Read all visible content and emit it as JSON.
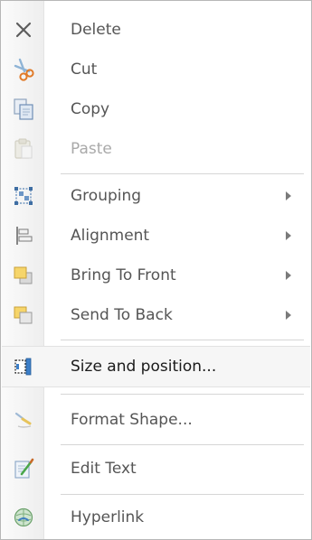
{
  "menu": {
    "items": [
      {
        "label": "Delete",
        "icon": "delete-x-icon"
      },
      {
        "label": "Cut",
        "icon": "scissors-icon"
      },
      {
        "label": "Copy",
        "icon": "copy-icon"
      },
      {
        "label": "Paste",
        "icon": "paste-icon",
        "enabled": false
      },
      {
        "label": "Grouping",
        "icon": "grouping-icon",
        "submenu": true
      },
      {
        "label": "Alignment",
        "icon": "alignment-icon",
        "submenu": true
      },
      {
        "label": "Bring To Front",
        "icon": "bring-to-front-icon",
        "submenu": true
      },
      {
        "label": "Send To Back",
        "icon": "send-to-back-icon",
        "submenu": true
      },
      {
        "label": "Size and position...",
        "icon": "size-position-icon",
        "highlighted": true
      },
      {
        "label": "Format Shape...",
        "icon": "format-shape-icon"
      },
      {
        "label": "Edit Text",
        "icon": "edit-text-icon"
      },
      {
        "label": "Hyperlink",
        "icon": "hyperlink-icon"
      }
    ]
  },
  "colors": {
    "text": "#555555",
    "disabled_text": "#a9a9a9",
    "highlight_background": "#f6f6f6",
    "separator": "#d6d6d6",
    "border": "#b7b7b7"
  }
}
